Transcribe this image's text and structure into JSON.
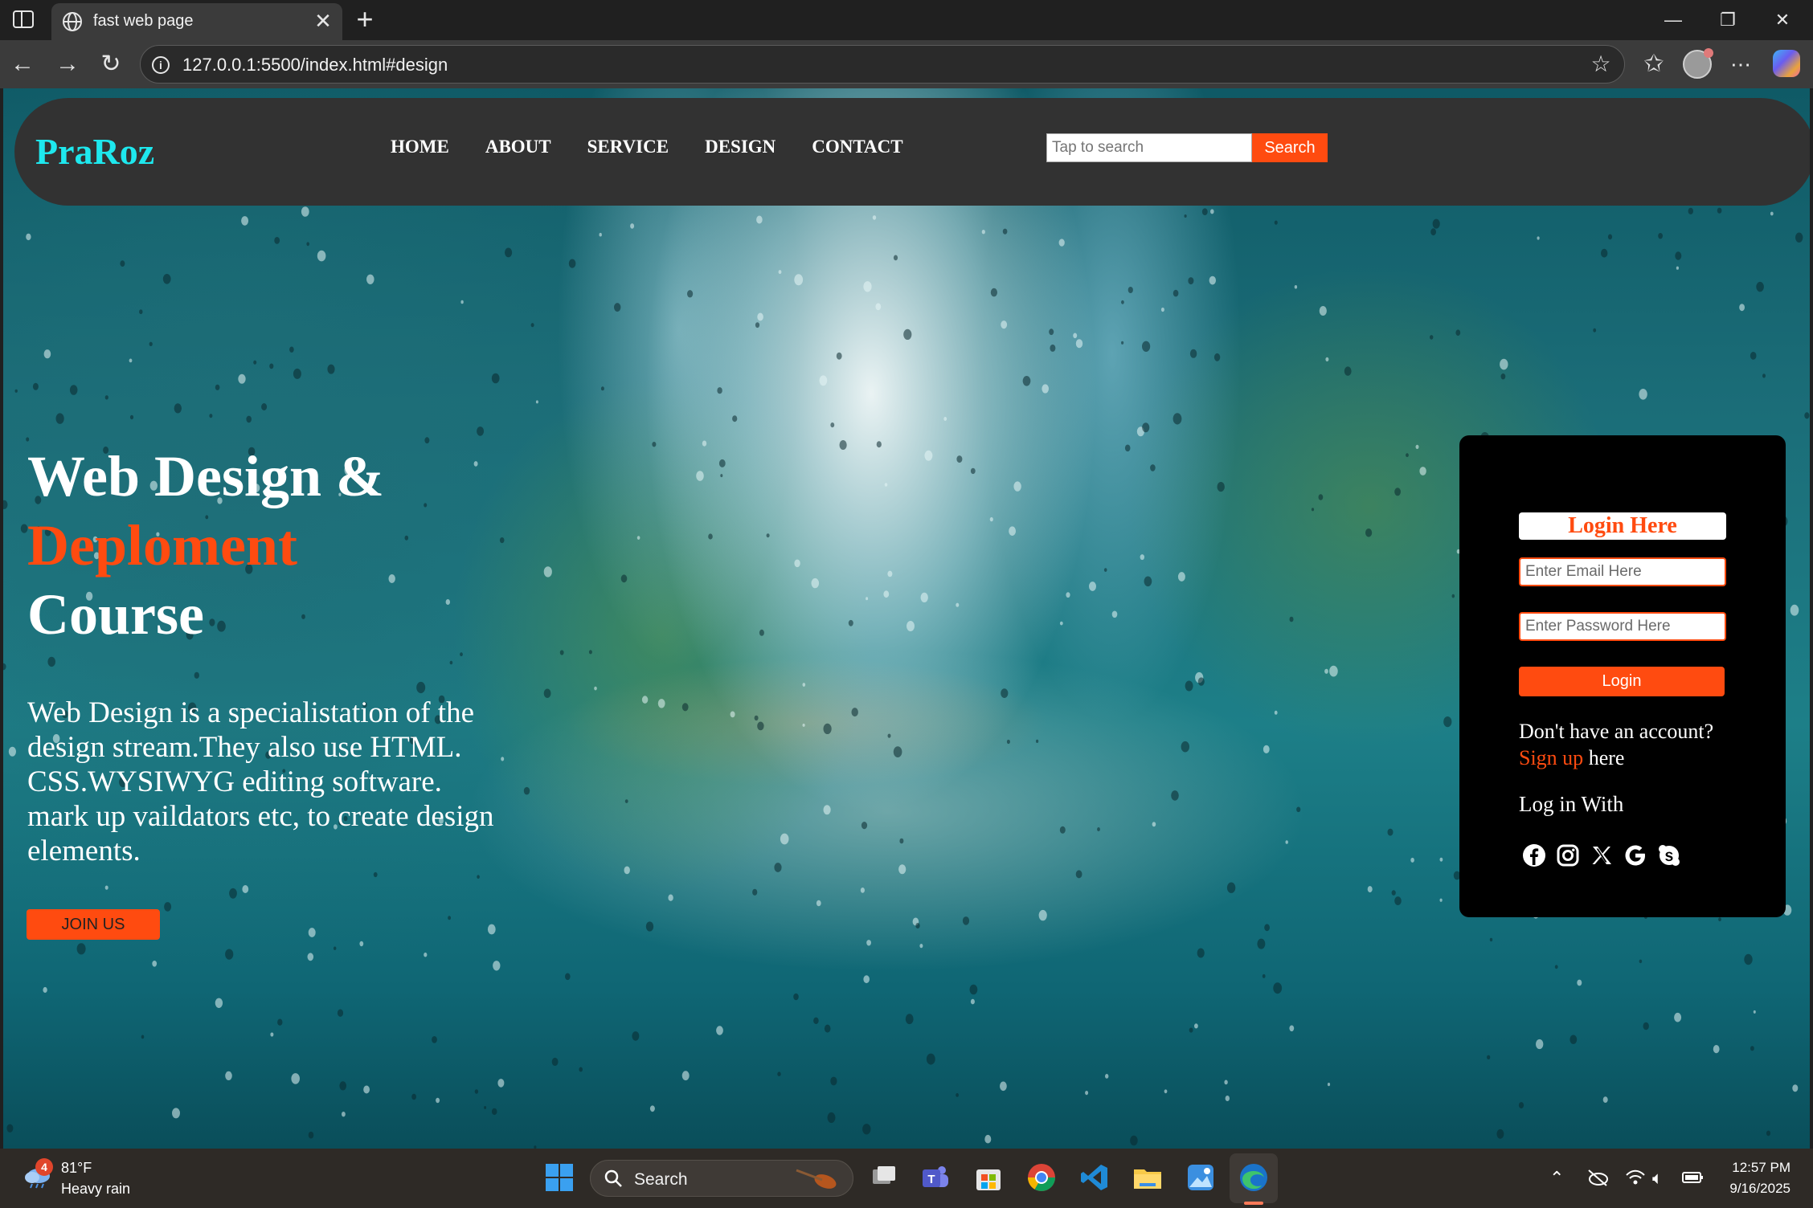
{
  "browser": {
    "tab_title": "fast web page",
    "url": "127.0.0.1:5500/index.html#design",
    "new_tab_glyph": "+",
    "close_glyph": "✕"
  },
  "site": {
    "logo": "PraRoz",
    "nav": [
      "HOME",
      "ABOUT",
      "SERVICE",
      "DESIGN",
      "CONTACT"
    ],
    "search_placeholder": "Tap to search",
    "search_button": "Search"
  },
  "hero": {
    "title_line1": "Web Design &",
    "title_line2": "Deploment",
    "title_line3": "Course",
    "description": "Web Design is a specialistation of the design stream.They also use HTML. CSS.WYSIWYG editing software. mark up vaildators etc, to create design elements.",
    "join_button": "JOIN US"
  },
  "login": {
    "heading": "Login Here",
    "email_placeholder": "Enter Email Here",
    "password_placeholder": "Enter Password Here",
    "login_button": "Login",
    "signup_prefix": "Don't have an account?",
    "signup_link": "Sign up",
    "signup_suffix": "here",
    "login_with": "Log in With",
    "social_icons": [
      "facebook-icon",
      "instagram-icon",
      "x-icon",
      "google-icon",
      "skype-icon"
    ]
  },
  "taskbar": {
    "weather_badge": "4",
    "weather_temp": "81°F",
    "weather_condition": "Heavy rain",
    "search_label": "Search",
    "time": "12:57 PM",
    "date": "9/16/2025"
  },
  "colors": {
    "accent": "#ff4b10",
    "logo": "#1ee8ee",
    "header_bg": "#323232"
  }
}
